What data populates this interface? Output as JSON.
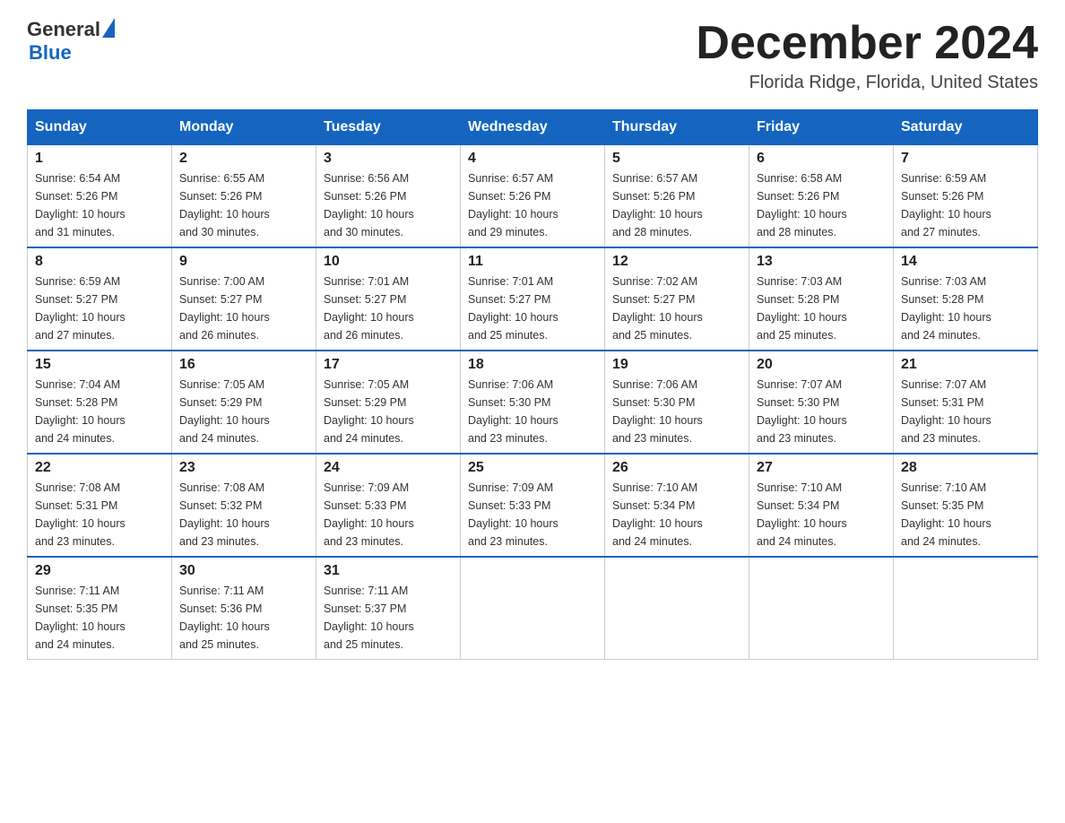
{
  "header": {
    "logo_general": "General",
    "logo_blue": "Blue",
    "month_title": "December 2024",
    "location": "Florida Ridge, Florida, United States"
  },
  "days_of_week": [
    "Sunday",
    "Monday",
    "Tuesday",
    "Wednesday",
    "Thursday",
    "Friday",
    "Saturday"
  ],
  "weeks": [
    [
      {
        "day": "1",
        "sunrise": "6:54 AM",
        "sunset": "5:26 PM",
        "daylight": "10 hours and 31 minutes."
      },
      {
        "day": "2",
        "sunrise": "6:55 AM",
        "sunset": "5:26 PM",
        "daylight": "10 hours and 30 minutes."
      },
      {
        "day": "3",
        "sunrise": "6:56 AM",
        "sunset": "5:26 PM",
        "daylight": "10 hours and 30 minutes."
      },
      {
        "day": "4",
        "sunrise": "6:57 AM",
        "sunset": "5:26 PM",
        "daylight": "10 hours and 29 minutes."
      },
      {
        "day": "5",
        "sunrise": "6:57 AM",
        "sunset": "5:26 PM",
        "daylight": "10 hours and 28 minutes."
      },
      {
        "day": "6",
        "sunrise": "6:58 AM",
        "sunset": "5:26 PM",
        "daylight": "10 hours and 28 minutes."
      },
      {
        "day": "7",
        "sunrise": "6:59 AM",
        "sunset": "5:26 PM",
        "daylight": "10 hours and 27 minutes."
      }
    ],
    [
      {
        "day": "8",
        "sunrise": "6:59 AM",
        "sunset": "5:27 PM",
        "daylight": "10 hours and 27 minutes."
      },
      {
        "day": "9",
        "sunrise": "7:00 AM",
        "sunset": "5:27 PM",
        "daylight": "10 hours and 26 minutes."
      },
      {
        "day": "10",
        "sunrise": "7:01 AM",
        "sunset": "5:27 PM",
        "daylight": "10 hours and 26 minutes."
      },
      {
        "day": "11",
        "sunrise": "7:01 AM",
        "sunset": "5:27 PM",
        "daylight": "10 hours and 25 minutes."
      },
      {
        "day": "12",
        "sunrise": "7:02 AM",
        "sunset": "5:27 PM",
        "daylight": "10 hours and 25 minutes."
      },
      {
        "day": "13",
        "sunrise": "7:03 AM",
        "sunset": "5:28 PM",
        "daylight": "10 hours and 25 minutes."
      },
      {
        "day": "14",
        "sunrise": "7:03 AM",
        "sunset": "5:28 PM",
        "daylight": "10 hours and 24 minutes."
      }
    ],
    [
      {
        "day": "15",
        "sunrise": "7:04 AM",
        "sunset": "5:28 PM",
        "daylight": "10 hours and 24 minutes."
      },
      {
        "day": "16",
        "sunrise": "7:05 AM",
        "sunset": "5:29 PM",
        "daylight": "10 hours and 24 minutes."
      },
      {
        "day": "17",
        "sunrise": "7:05 AM",
        "sunset": "5:29 PM",
        "daylight": "10 hours and 24 minutes."
      },
      {
        "day": "18",
        "sunrise": "7:06 AM",
        "sunset": "5:30 PM",
        "daylight": "10 hours and 23 minutes."
      },
      {
        "day": "19",
        "sunrise": "7:06 AM",
        "sunset": "5:30 PM",
        "daylight": "10 hours and 23 minutes."
      },
      {
        "day": "20",
        "sunrise": "7:07 AM",
        "sunset": "5:30 PM",
        "daylight": "10 hours and 23 minutes."
      },
      {
        "day": "21",
        "sunrise": "7:07 AM",
        "sunset": "5:31 PM",
        "daylight": "10 hours and 23 minutes."
      }
    ],
    [
      {
        "day": "22",
        "sunrise": "7:08 AM",
        "sunset": "5:31 PM",
        "daylight": "10 hours and 23 minutes."
      },
      {
        "day": "23",
        "sunrise": "7:08 AM",
        "sunset": "5:32 PM",
        "daylight": "10 hours and 23 minutes."
      },
      {
        "day": "24",
        "sunrise": "7:09 AM",
        "sunset": "5:33 PM",
        "daylight": "10 hours and 23 minutes."
      },
      {
        "day": "25",
        "sunrise": "7:09 AM",
        "sunset": "5:33 PM",
        "daylight": "10 hours and 23 minutes."
      },
      {
        "day": "26",
        "sunrise": "7:10 AM",
        "sunset": "5:34 PM",
        "daylight": "10 hours and 24 minutes."
      },
      {
        "day": "27",
        "sunrise": "7:10 AM",
        "sunset": "5:34 PM",
        "daylight": "10 hours and 24 minutes."
      },
      {
        "day": "28",
        "sunrise": "7:10 AM",
        "sunset": "5:35 PM",
        "daylight": "10 hours and 24 minutes."
      }
    ],
    [
      {
        "day": "29",
        "sunrise": "7:11 AM",
        "sunset": "5:35 PM",
        "daylight": "10 hours and 24 minutes."
      },
      {
        "day": "30",
        "sunrise": "7:11 AM",
        "sunset": "5:36 PM",
        "daylight": "10 hours and 25 minutes."
      },
      {
        "day": "31",
        "sunrise": "7:11 AM",
        "sunset": "5:37 PM",
        "daylight": "10 hours and 25 minutes."
      },
      null,
      null,
      null,
      null
    ]
  ],
  "labels": {
    "sunrise": "Sunrise:",
    "sunset": "Sunset:",
    "daylight": "Daylight:"
  }
}
